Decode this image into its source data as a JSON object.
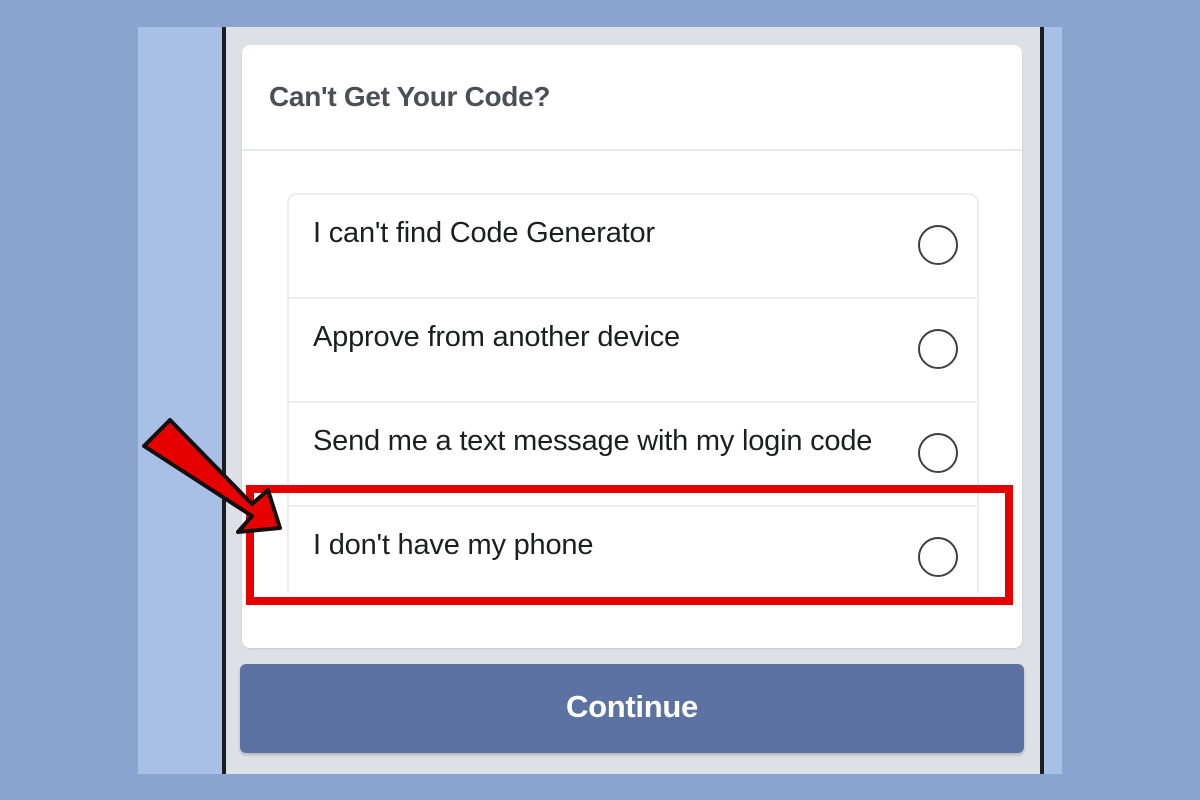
{
  "dialog": {
    "title": "Can't Get Your Code?"
  },
  "options": [
    {
      "label": "I can't find Code Generator",
      "selected": false
    },
    {
      "label": "Approve from another device",
      "selected": false
    },
    {
      "label": "Send me a text message with my login code",
      "selected": false
    },
    {
      "label": "I don't have my phone",
      "selected": false,
      "highlighted": true
    }
  ],
  "continue_button": {
    "label": "Continue",
    "color": "#5b72a3"
  },
  "annotation": {
    "highlight_color": "#e60000",
    "pointer_icon": "red-arrow-icon"
  },
  "colors": {
    "background": "#8aa3cf",
    "dialog": "#ffffff"
  }
}
